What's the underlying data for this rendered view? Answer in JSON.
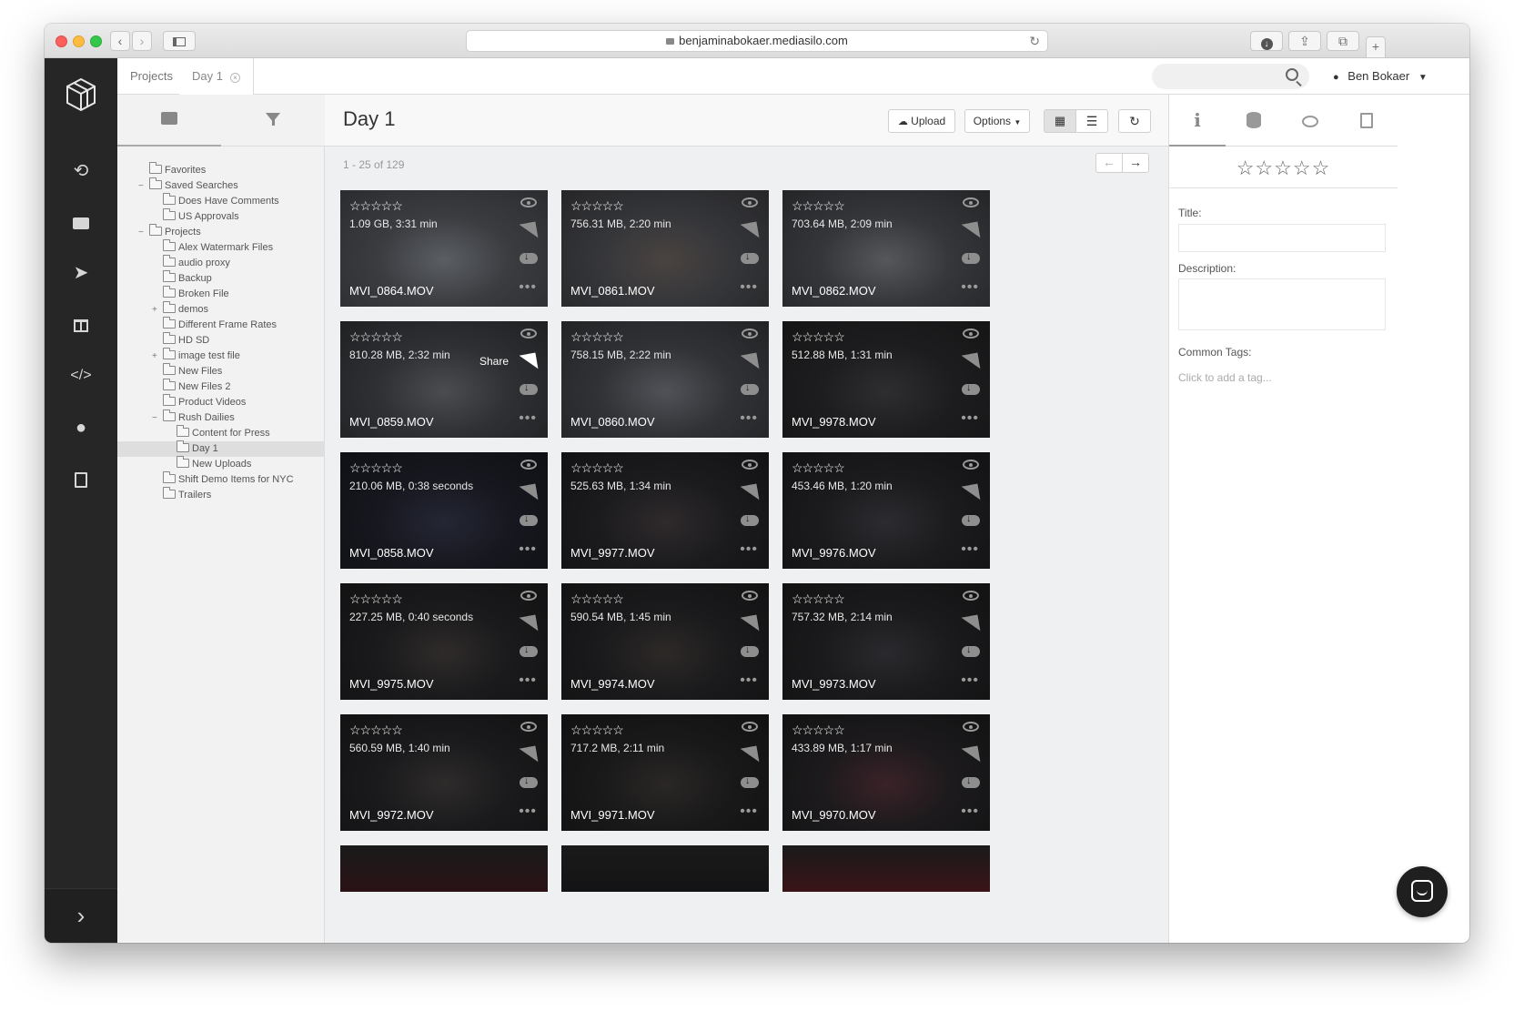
{
  "browser": {
    "url": "benjaminabokaer.mediasilo.com"
  },
  "header": {
    "tabs": [
      {
        "label": "Projects"
      },
      {
        "label": "Day 1"
      }
    ],
    "search_placeholder": "",
    "user_name": "Ben Bokaer"
  },
  "tree": {
    "items": [
      {
        "label": "Favorites",
        "depth": 0
      },
      {
        "label": "Saved Searches",
        "depth": 0
      },
      {
        "label": "Does Have Comments",
        "depth": 1
      },
      {
        "label": "US Approvals",
        "depth": 1
      },
      {
        "label": "Projects",
        "depth": 0
      },
      {
        "label": "Alex Watermark Files",
        "depth": 1
      },
      {
        "label": "audio proxy",
        "depth": 1
      },
      {
        "label": "Backup",
        "depth": 1
      },
      {
        "label": "Broken File",
        "depth": 1
      },
      {
        "label": "demos",
        "depth": 1
      },
      {
        "label": "Different Frame Rates",
        "depth": 1
      },
      {
        "label": "HD SD",
        "depth": 1
      },
      {
        "label": "image test file",
        "depth": 1
      },
      {
        "label": "New Files",
        "depth": 1
      },
      {
        "label": "New Files 2",
        "depth": 1
      },
      {
        "label": "Product Videos",
        "depth": 1
      },
      {
        "label": "Rush Dailies",
        "depth": 1
      },
      {
        "label": "Content for Press",
        "depth": 2
      },
      {
        "label": "Day 1",
        "depth": 2
      },
      {
        "label": "New Uploads",
        "depth": 2
      },
      {
        "label": "Shift Demo Items for NYC",
        "depth": 1
      },
      {
        "label": "Trailers",
        "depth": 1
      }
    ]
  },
  "main": {
    "title": "Day 1",
    "upload_label": "Upload",
    "options_label": "Options",
    "count_text": "1 - 25 of 129",
    "assets": [
      {
        "meta": "1.09 GB, 3:31 min",
        "name": "MVI_0864.MOV"
      },
      {
        "meta": "756.31 MB, 2:20 min",
        "name": "MVI_0861.MOV"
      },
      {
        "meta": "703.64 MB, 2:09 min",
        "name": "MVI_0862.MOV"
      },
      {
        "meta": "810.28 MB, 2:32 min",
        "name": "MVI_0859.MOV",
        "hover_label": "Share"
      },
      {
        "meta": "758.15 MB, 2:22 min",
        "name": "MVI_0860.MOV"
      },
      {
        "meta": "512.88 MB, 1:31 min",
        "name": "MVI_9978.MOV"
      },
      {
        "meta": "210.06 MB, 0:38 seconds",
        "name": "MVI_0858.MOV"
      },
      {
        "meta": "525.63 MB, 1:34 min",
        "name": "MVI_9977.MOV"
      },
      {
        "meta": "453.46 MB, 1:20 min",
        "name": "MVI_9976.MOV"
      },
      {
        "meta": "227.25 MB, 0:40 seconds",
        "name": "MVI_9975.MOV"
      },
      {
        "meta": "590.54 MB, 1:45 min",
        "name": "MVI_9974.MOV"
      },
      {
        "meta": "757.32 MB, 2:14 min",
        "name": "MVI_9973.MOV"
      },
      {
        "meta": "560.59 MB, 1:40 min",
        "name": "MVI_9972.MOV"
      },
      {
        "meta": "717.2 MB, 2:11 min",
        "name": "MVI_9971.MOV"
      },
      {
        "meta": "433.89 MB, 1:17 min",
        "name": "MVI_9970.MOV"
      }
    ],
    "rating_stars": "☆☆☆☆☆"
  },
  "details": {
    "title_label": "Title:",
    "description_label": "Description:",
    "tags_label": "Common Tags:",
    "tags_placeholder": "Click to add a tag...",
    "stars": "☆☆☆☆☆"
  },
  "colors": {
    "nav_bg": "#262626",
    "content_bg": "#eef0f1",
    "card_bg": "#1c1c1c"
  }
}
